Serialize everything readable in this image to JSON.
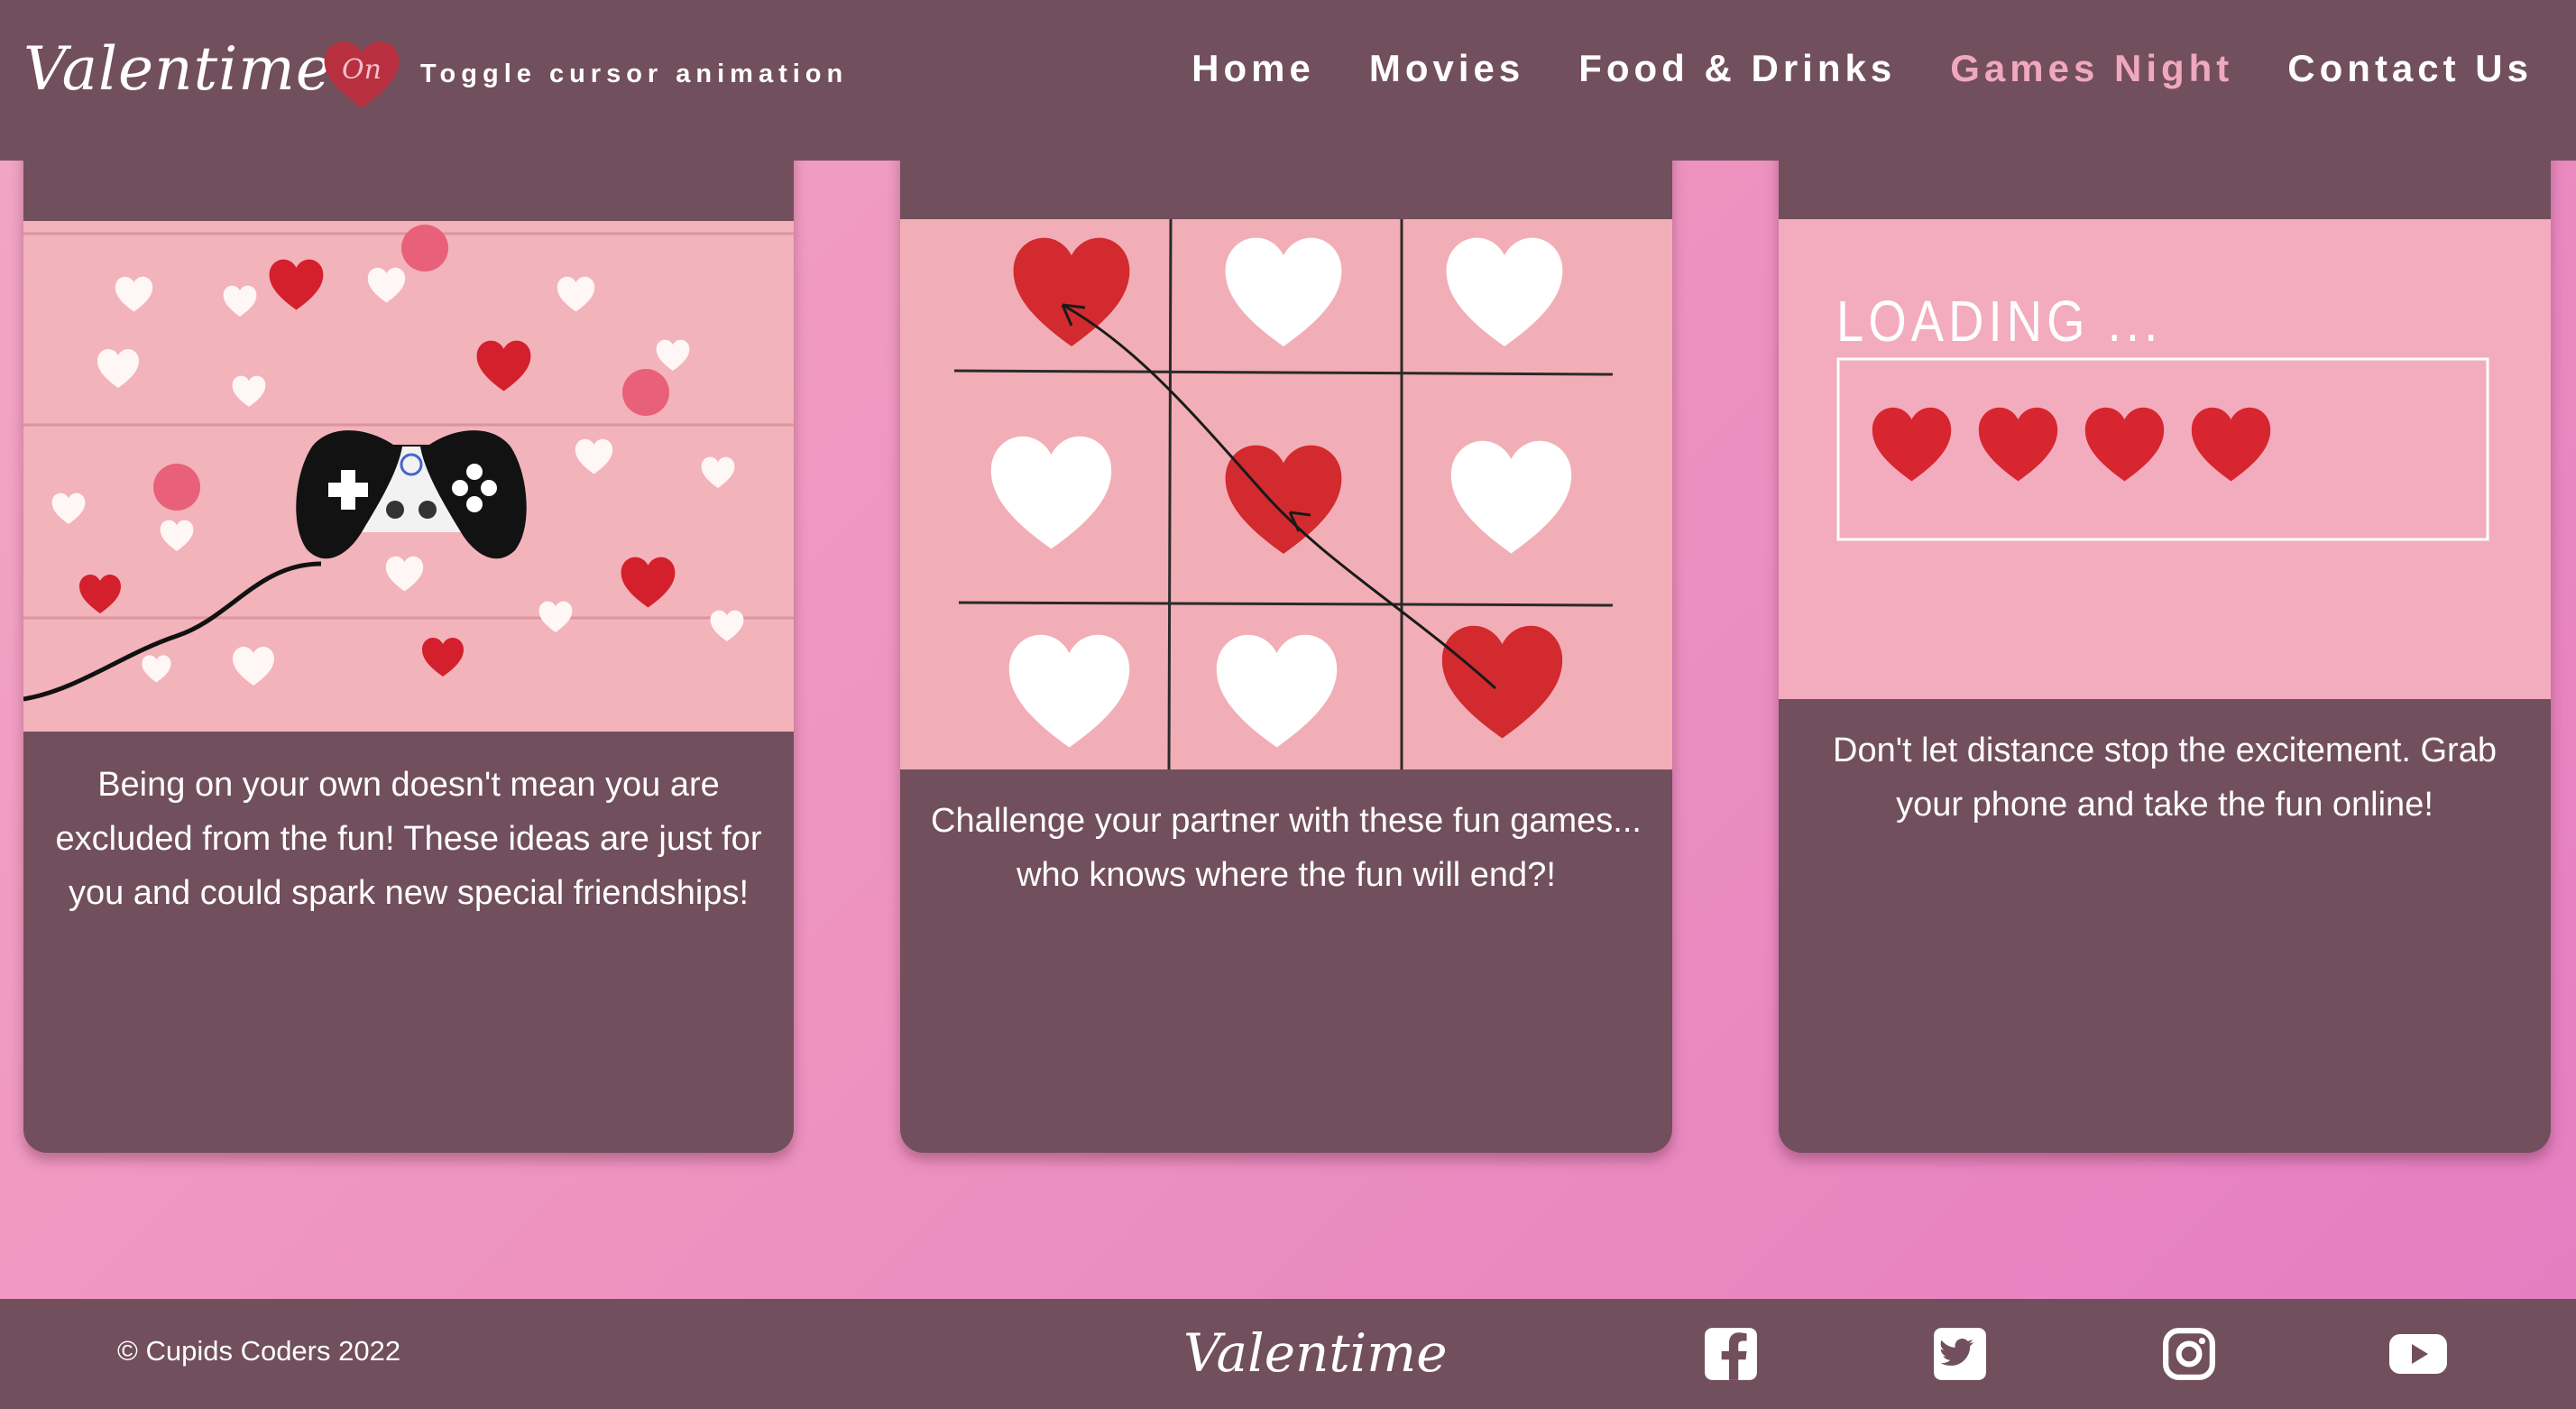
{
  "header": {
    "brand": "Valentime",
    "toggle_state": "On",
    "toggle_label": "Toggle cursor animation",
    "nav": [
      {
        "label": "Home",
        "active": false
      },
      {
        "label": "Movies",
        "active": false
      },
      {
        "label": "Food & Drinks",
        "active": false
      },
      {
        "label": "Games Night",
        "active": true
      },
      {
        "label": "Contact Us",
        "active": false
      }
    ]
  },
  "cards": [
    {
      "image_icon": "game-controller-hearts-image",
      "text": "Being on your own doesn't mean you are excluded from the fun! These ideas are just for you and could spark new special friendships!"
    },
    {
      "image_icon": "tic-tac-toe-hearts-image",
      "text": "Challenge your partner with these fun games... who knows where the fun will end?!"
    },
    {
      "image_icon": "loading-hearts-image",
      "image_text": "LOADING ...",
      "text": "Don't let distance stop the excitement. Grab your phone and take the fun online!"
    }
  ],
  "footer": {
    "copyright": "© Cupids Coders 2022",
    "brand": "Valentime",
    "social": [
      "facebook-icon",
      "twitter-icon",
      "instagram-icon",
      "youtube-icon"
    ]
  },
  "colors": {
    "panel": "#724f5c",
    "accent": "#f0a8be",
    "background": "#ee93c0",
    "heart_red": "#d9262e"
  }
}
